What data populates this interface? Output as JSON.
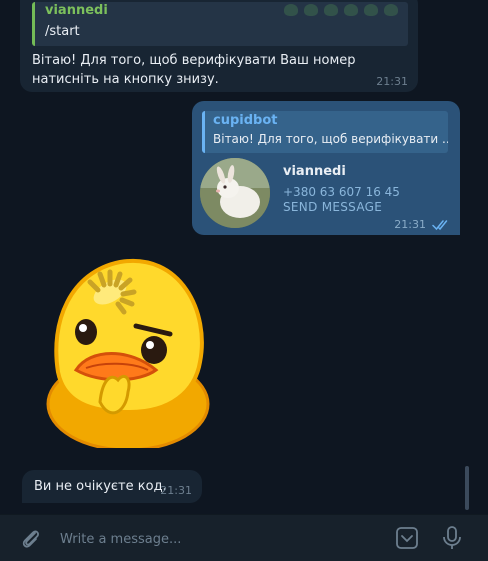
{
  "colors": {
    "background": "#0e1621",
    "incoming_bubble": "#182533",
    "outgoing_bubble": "#2b5278",
    "accent_blue": "#6ab3f3",
    "accent_green": "#7cc05c"
  },
  "messages": [
    {
      "reply_name": "viannedi",
      "reply_text": "/start",
      "text": "Вітаю! Для того, щоб верифікувати Ваш номер натисніть на кнопку знизу.",
      "time": "21:31"
    },
    {
      "reply_name": "cupidbot",
      "reply_text": "Вітаю! Для того, щоб верифікувати ...",
      "contact_name": "viannedi",
      "contact_phone": "+380 63 607 16 45",
      "contact_action": "SEND MESSAGE",
      "time": "21:31",
      "status_icon": "double-check-icon"
    },
    {
      "sticker": "yellow-duck-thinking-sticker"
    },
    {
      "text": "Ви не очікуєте код.",
      "time": "21:31"
    }
  ],
  "composer": {
    "placeholder": "Write a message...",
    "attach_icon": "paperclip-icon",
    "emoji_icon": "emoji-panel-icon",
    "mic_icon": "microphone-icon"
  }
}
